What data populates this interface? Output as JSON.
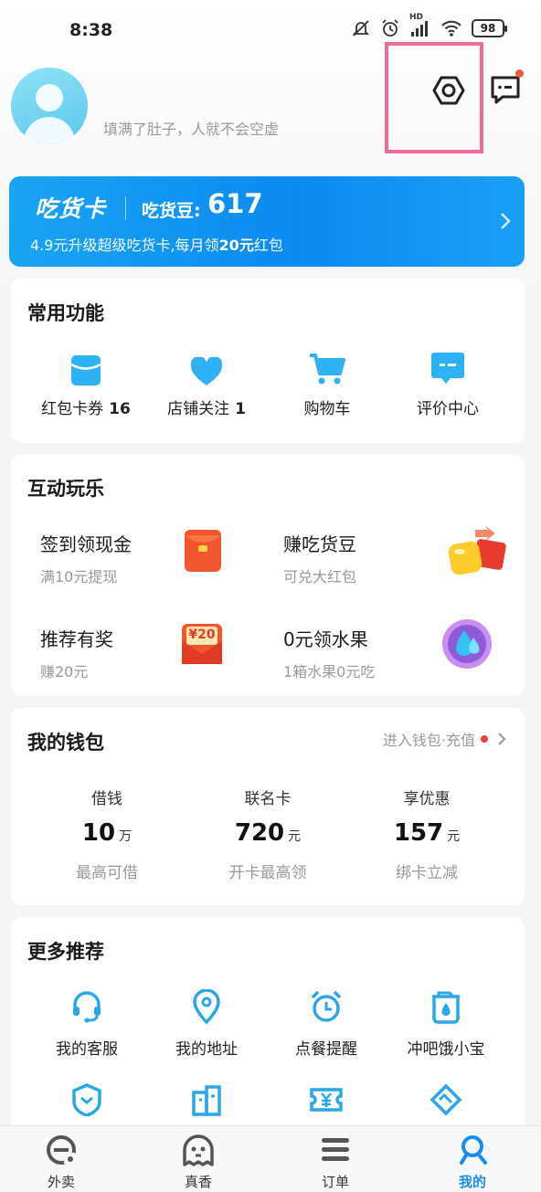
{
  "status_bar": {
    "time": "8:38",
    "network_label": "HD",
    "battery": "98",
    "icons": [
      "mute-icon",
      "alarm-icon",
      "signal-icon",
      "wifi-icon",
      "battery-icon"
    ]
  },
  "profile": {
    "slogan": "填满了肚子，人就不会空虚"
  },
  "header_icons": {
    "settings": "settings-icon",
    "message": "message-icon",
    "message_has_badge": true
  },
  "foodie_card": {
    "title": "吃货卡",
    "beans_label": "吃货豆:",
    "beans_value": "617",
    "promo_prefix": "4.9元升级超级吃货卡,每月领",
    "promo_highlight": "20元",
    "promo_suffix": "红包"
  },
  "common_functions": {
    "title": "常用功能",
    "items": [
      {
        "label": "红包卡券",
        "count": "16",
        "icon": "coupon-icon"
      },
      {
        "label": "店铺关注",
        "count": "1",
        "icon": "heart-icon"
      },
      {
        "label": "购物车",
        "count": "",
        "icon": "cart-icon"
      },
      {
        "label": "评价中心",
        "count": "",
        "icon": "review-icon"
      }
    ]
  },
  "interactive_fun": {
    "title": "互动玩乐",
    "items": [
      {
        "title": "签到领现金",
        "subtitle": "满10元提现",
        "icon": "red-envelope-icon"
      },
      {
        "title": "赚吃货豆",
        "subtitle": "可兑大红包",
        "icon": "beans-gift-icon"
      },
      {
        "title": "推荐有奖",
        "subtitle": "赚20元",
        "icon": "reward-envelope-icon",
        "badge": "¥20"
      },
      {
        "title": "0元领水果",
        "subtitle": "1箱水果0元吃",
        "icon": "water-drop-icon"
      }
    ]
  },
  "wallet": {
    "title": "我的钱包",
    "link": "进入钱包·充值",
    "columns": [
      {
        "label": "借钱",
        "value": "10",
        "unit": "万",
        "sub": "最高可借"
      },
      {
        "label": "联名卡",
        "value": "720",
        "unit": "元",
        "sub": "开卡最高领"
      },
      {
        "label": "享优惠",
        "value": "157",
        "unit": "元",
        "sub": "绑卡立减"
      }
    ]
  },
  "more": {
    "title": "更多推荐",
    "items": [
      {
        "label": "我的客服",
        "icon": "headset-icon"
      },
      {
        "label": "我的地址",
        "icon": "location-icon"
      },
      {
        "label": "点餐提醒",
        "icon": "alarm-clock-icon"
      },
      {
        "label": "冲吧饿小宝",
        "icon": "water-cup-icon"
      }
    ],
    "partial_icons": [
      "shield-icon",
      "building-icon",
      "ticket-icon",
      "handshake-icon"
    ]
  },
  "bottom_nav": {
    "items": [
      {
        "label": "外卖",
        "icon": "takeout-icon",
        "active": false
      },
      {
        "label": "真香",
        "icon": "ghost-icon",
        "active": false
      },
      {
        "label": "订单",
        "icon": "order-list-icon",
        "active": false
      },
      {
        "label": "我的",
        "icon": "person-icon",
        "active": true
      }
    ]
  },
  "colors": {
    "accent": "#1a8cf0",
    "highlight_box": "#f06b9b",
    "badge_red": "#f25a3c"
  }
}
